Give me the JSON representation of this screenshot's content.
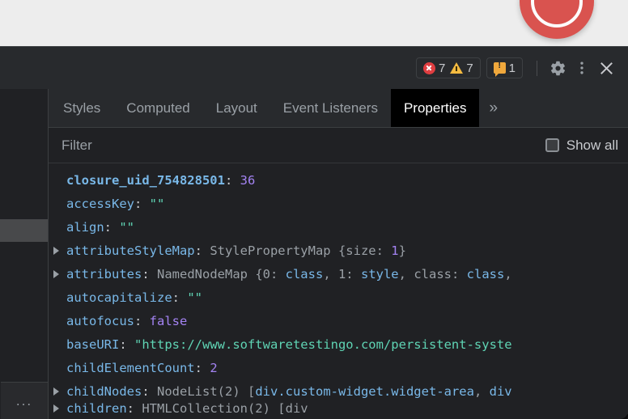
{
  "page": {
    "decoration_icon": "red-circle-logo",
    "accent_red": "#d9534f",
    "background": "#ededed"
  },
  "devtools": {
    "toolbar": {
      "issues": [
        {
          "icon": "error-icon",
          "label": "7",
          "color": "#e03e41"
        },
        {
          "icon": "warning-icon",
          "label": "7",
          "color": "#f5bb41"
        }
      ],
      "message_badge": {
        "icon": "issue-message-icon",
        "label": "1",
        "color": "#f0a83c"
      },
      "settings_icon": "gear-icon",
      "more_icon": "kebab-menu-icon",
      "close_icon": "close-icon"
    },
    "tabs": [
      {
        "label": "Styles",
        "active": false
      },
      {
        "label": "Computed",
        "active": false
      },
      {
        "label": "Layout",
        "active": false
      },
      {
        "label": "Event Listeners",
        "active": false
      },
      {
        "label": "Properties",
        "active": true
      }
    ],
    "tab_overflow_icon": "chevron-double-right-icon",
    "filter": {
      "placeholder": "Filter",
      "value": "",
      "show_all_label": "Show all",
      "show_all_checked": false
    },
    "left_panel": {
      "more_label": "..."
    },
    "properties": [
      {
        "expandable": false,
        "own": true,
        "name": "closure_uid_754828501",
        "value": "36",
        "value_type": "num"
      },
      {
        "expandable": false,
        "own": false,
        "name": "accessKey",
        "value": "\"\"",
        "value_type": "str"
      },
      {
        "expandable": false,
        "own": false,
        "name": "align",
        "value": "\"\"",
        "value_type": "str"
      },
      {
        "expandable": true,
        "own": false,
        "name": "attributeStyleMap",
        "value": "StylePropertyMap {size: 1}",
        "value_type": "obj",
        "value_html": "StylePropertyMap {size: <span class=\"v-num\">1</span>}"
      },
      {
        "expandable": true,
        "own": false,
        "name": "attributes",
        "value": "NamedNodeMap {0: class, 1: style, class: class,",
        "value_type": "obj",
        "value_html": "NamedNodeMap {0: <span class=\"v-node\">class</span>, 1: <span class=\"v-node\">style</span>, class: <span class=\"v-node\">class</span>,"
      },
      {
        "expandable": false,
        "own": false,
        "name": "autocapitalize",
        "value": "\"\"",
        "value_type": "str"
      },
      {
        "expandable": false,
        "own": false,
        "name": "autofocus",
        "value": "false",
        "value_type": "bool"
      },
      {
        "expandable": false,
        "own": false,
        "name": "baseURI",
        "value": "\"https://www.softwaretestingo.com/persistent-syste",
        "value_type": "str"
      },
      {
        "expandable": false,
        "own": false,
        "name": "childElementCount",
        "value": "2",
        "value_type": "num"
      },
      {
        "expandable": true,
        "own": false,
        "name": "childNodes",
        "value": "NodeList(2) [div.custom-widget.widget-area, div",
        "value_type": "obj",
        "value_html": "NodeList(2) [<span class=\"v-node\">div.custom-widget.widget-area</span>, <span class=\"v-node\">div</span>"
      }
    ]
  }
}
